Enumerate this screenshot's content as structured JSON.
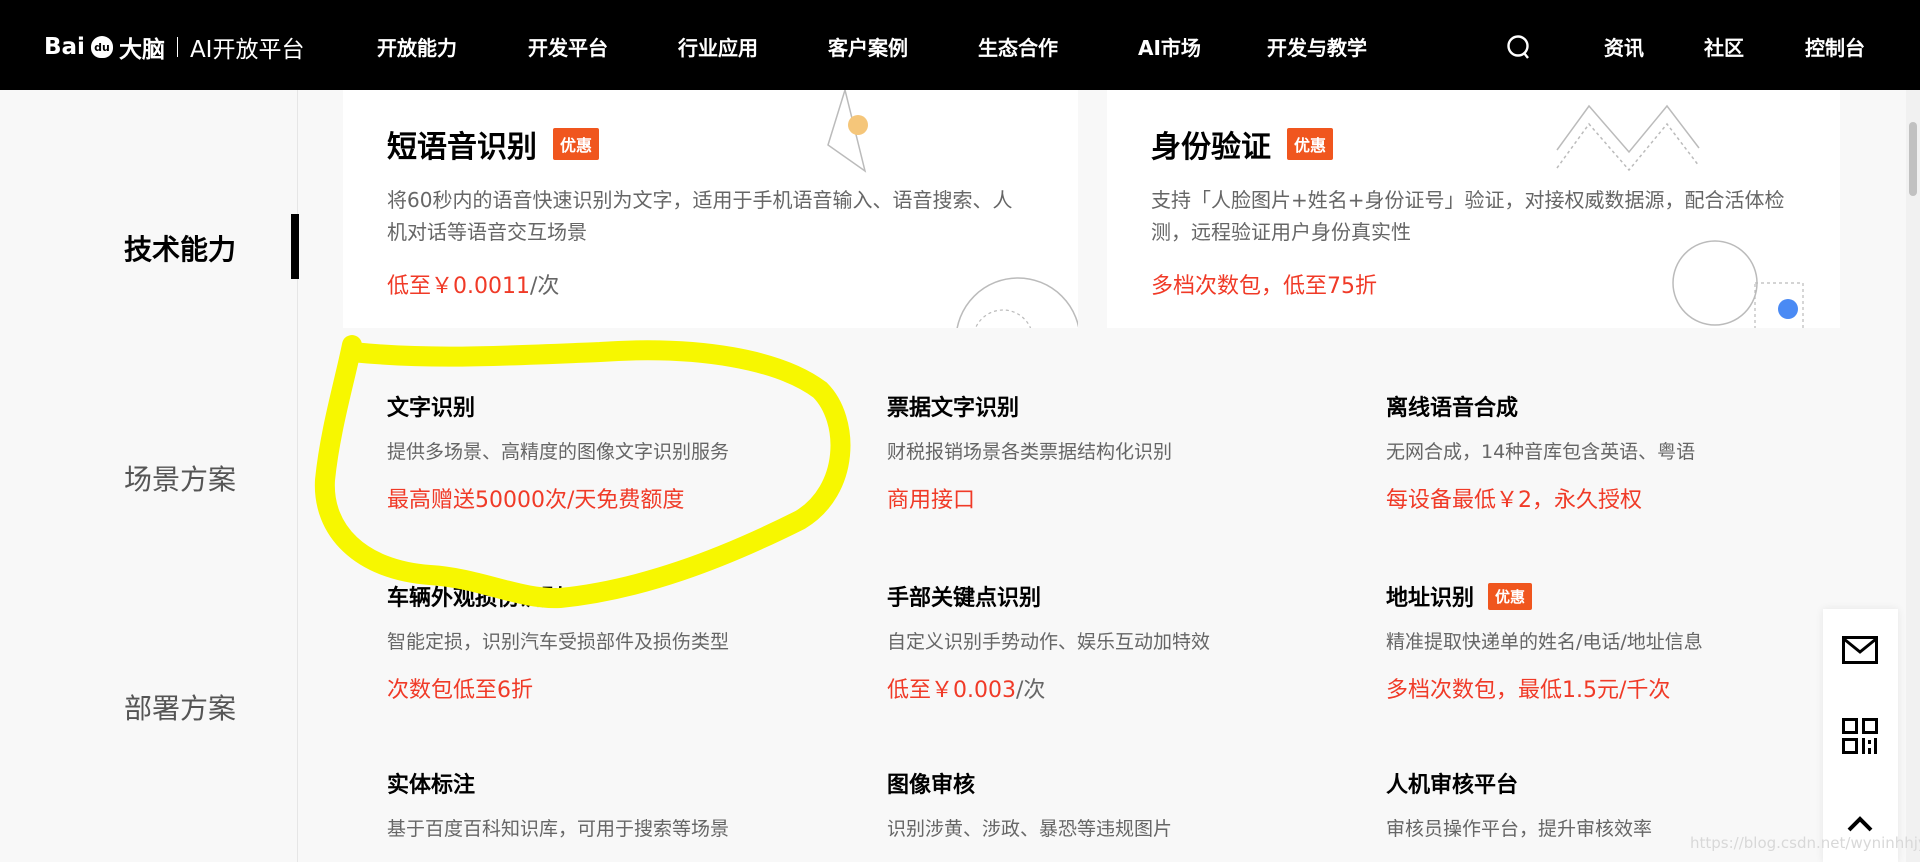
{
  "header": {
    "logo": {
      "brand": "Bai",
      "paw": "du",
      "name": "大脑",
      "product": "AI开放平台"
    },
    "nav": [
      "开放能力",
      "开发平台",
      "行业应用",
      "客户案例",
      "生态合作",
      "AI市场",
      "开发与教学"
    ],
    "right": [
      "资讯",
      "社区",
      "控制台"
    ]
  },
  "sidebar": {
    "items": [
      "技术能力",
      "场景方案",
      "部署方案"
    ],
    "active": "技术能力"
  },
  "featured": [
    {
      "title": "短语音识别",
      "badge": "优惠",
      "desc": "将60秒内的语音快速识别为文字，适用于手机语音输入、语音搜索、人机对话等语音交互场景",
      "price": "低至￥0.0011",
      "price_unit": "/次"
    },
    {
      "title": "身份验证",
      "badge": "优惠",
      "desc": "支持「人脸图片+姓名+身份证号」验证，对接权威数据源，配合活体检测，远程验证用户身份真实性",
      "price": "多档次数包，低至75折",
      "price_unit": ""
    }
  ],
  "products": [
    {
      "title": "文字识别",
      "badge": "",
      "desc": "提供多场景、高精度的图像文字识别服务",
      "price": "最高赠送50000次/天免费额度",
      "price_unit": ""
    },
    {
      "title": "票据文字识别",
      "badge": "",
      "desc": "财税报销场景各类票据结构化识别",
      "price": "商用接口",
      "price_unit": ""
    },
    {
      "title": "离线语音合成",
      "badge": "",
      "desc": "无网合成，14种音库包含英语、粤语",
      "price": "每设备最低￥2，永久授权",
      "price_unit": ""
    },
    {
      "title": "车辆外观损伤识别",
      "badge": "",
      "desc": "智能定损，识别汽车受损部件及损伤类型",
      "price": "次数包低至6折",
      "price_unit": ""
    },
    {
      "title": "手部关键点识别",
      "badge": "",
      "desc": "自定义识别手势动作、娱乐互动加特效",
      "price": "低至￥0.003",
      "price_unit": "/次"
    },
    {
      "title": "地址识别",
      "badge": "优惠",
      "desc": "精准提取快递单的姓名/电话/地址信息",
      "price": "多档次数包，最低1.5元/千次",
      "price_unit": ""
    },
    {
      "title": "实体标注",
      "badge": "",
      "desc": "基于百度百科知识库，可用于搜索等场景",
      "price": "",
      "price_unit": ""
    },
    {
      "title": "图像审核",
      "badge": "",
      "desc": "识别涉黄、涉政、暴恐等违规图片",
      "price": "",
      "price_unit": ""
    },
    {
      "title": "人机审核平台",
      "badge": "",
      "desc": "审核员操作平台，提升审核效率",
      "price": "",
      "price_unit": ""
    }
  ],
  "float_tools": [
    "mail-icon",
    "qr-code-icon",
    "back-to-top-icon"
  ],
  "watermark": "https://blog.csdn.net/wyninhhjy",
  "colors": {
    "accent": "#f03a27",
    "badge": "#f0561e",
    "annotation": "#f7f700"
  }
}
